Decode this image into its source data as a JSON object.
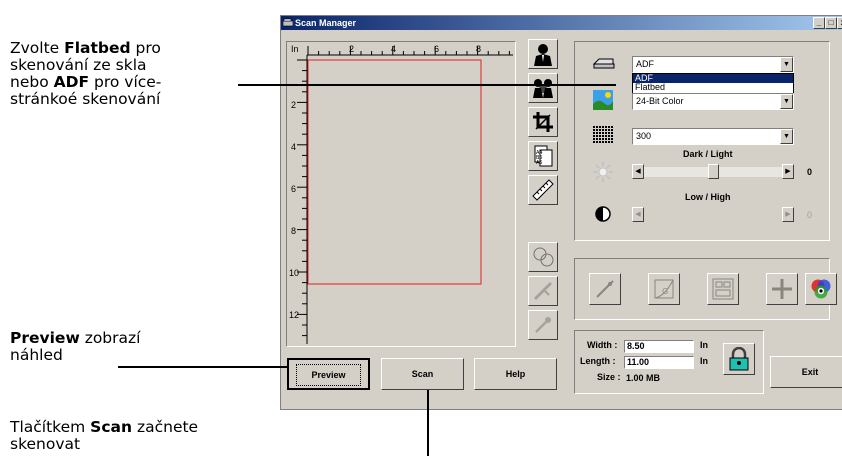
{
  "annotations": {
    "flatbed_line1_a": "Zvolte ",
    "flatbed_line1_b": "Flatbed",
    "flatbed_line1_c": " pro",
    "flatbed_line2": "skenování ze skla",
    "flatbed_line3_a": "nebo ",
    "flatbed_line3_b": "ADF",
    "flatbed_line3_c": " pro více-",
    "flatbed_line4": "stránkoé skenování",
    "preview_line1_a": "Preview",
    "preview_line1_b": " zobrazí",
    "preview_line2": "náhled",
    "scan_line1_a": "Tlačítkem ",
    "scan_line1_b": "Scan",
    "scan_line1_c": " začnete",
    "scan_line2": "skenovat"
  },
  "window": {
    "title": "Scan Manager",
    "minimize": "_",
    "maximize": "□",
    "close": "x"
  },
  "ruler": {
    "unit": "In",
    "top_ticks": [
      "2",
      "4",
      "6",
      "8"
    ],
    "left_ticks": [
      "2",
      "4",
      "6",
      "8",
      "10",
      "12"
    ]
  },
  "settings": {
    "source_value": "ADF",
    "source_options": [
      "ADF",
      "Flatbed"
    ],
    "mode_value": "24-Bit Color",
    "resolution_value": "300",
    "brightness_label": "Dark / Light",
    "brightness_value": "0",
    "brightness_level": 0.5,
    "contrast_label": "Low / High",
    "contrast_value": "0"
  },
  "buttons": {
    "preview": "Preview",
    "scan": "Scan",
    "help": "Help",
    "exit": "Exit"
  },
  "size": {
    "width_label": "Width :",
    "width_value": "8.50",
    "width_unit": "In",
    "length_label": "Length :",
    "length_value": "11.00",
    "length_unit": "In",
    "size_label": "Size :",
    "size_value": "1.00  MB"
  }
}
